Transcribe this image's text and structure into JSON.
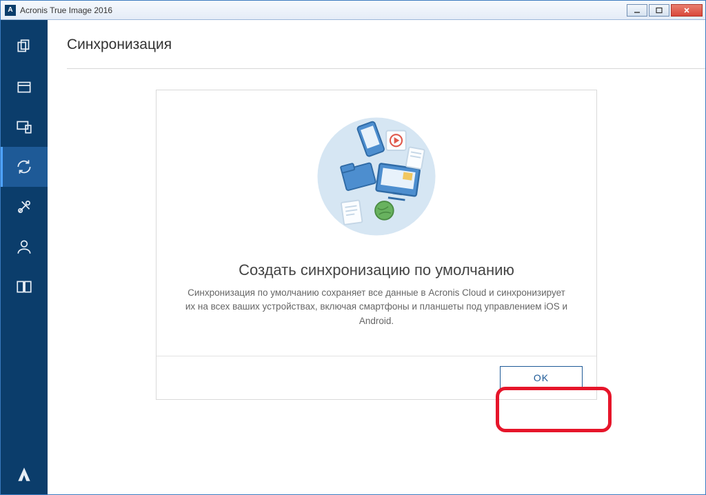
{
  "window": {
    "title": "Acronis True Image 2016"
  },
  "page": {
    "title": "Синхронизация"
  },
  "card": {
    "heading": "Создать синхронизацию по умолчанию",
    "description": "Синхронизация по умолчанию сохраняет все данные в Acronis Cloud и синхронизирует их на всех ваших устройствах, включая смартфоны и планшеты под управлением iOS и Android.",
    "ok_label": "OK"
  },
  "sidebar": {
    "items": [
      {
        "name": "backup"
      },
      {
        "name": "archive"
      },
      {
        "name": "clone"
      },
      {
        "name": "sync",
        "active": true
      },
      {
        "name": "tools"
      },
      {
        "name": "account"
      },
      {
        "name": "dashboard"
      }
    ],
    "logo": "Acronis"
  }
}
